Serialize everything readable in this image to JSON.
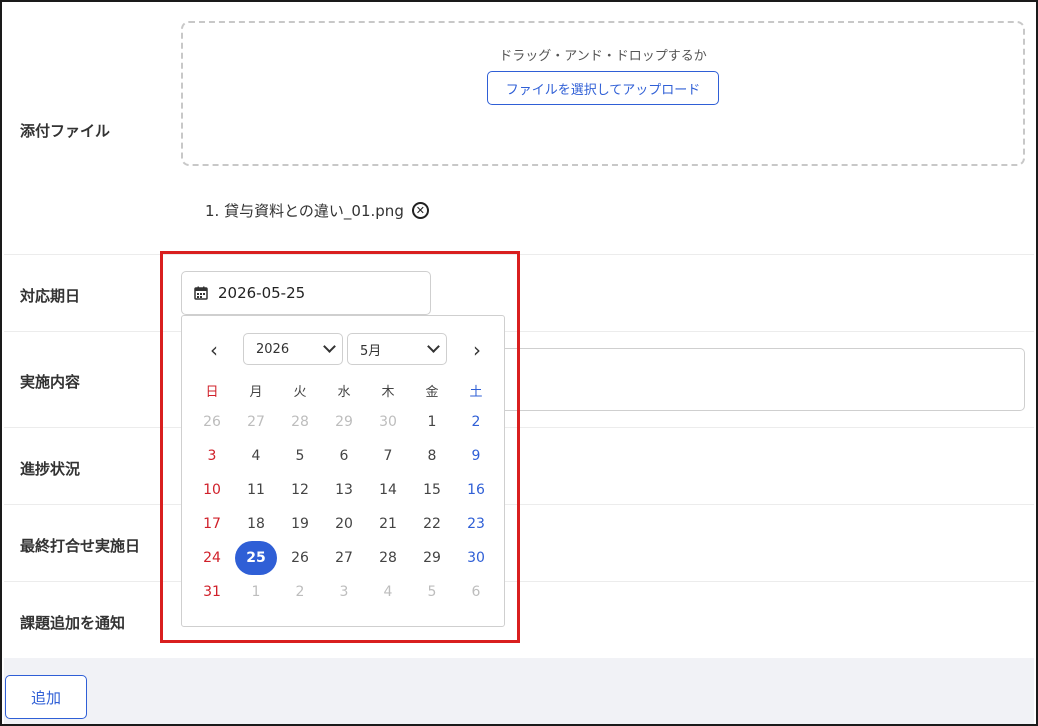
{
  "labels": {
    "attachment": "添付ファイル",
    "due_date": "対応期日",
    "content": "実施内容",
    "progress": "進捗状況",
    "last_meeting": "最終打合せ実施日",
    "notify": "課題追加を通知"
  },
  "dropzone": {
    "hint": "ドラッグ・アンド・ドロップするか",
    "button": "ファイルを選択してアップロード"
  },
  "files": [
    {
      "name": "1. 貸与資料との違い_01.png"
    }
  ],
  "date_input": {
    "value": "2026-05-25"
  },
  "calendar": {
    "year": "2026",
    "month": "5月",
    "weekdays": [
      "日",
      "月",
      "火",
      "水",
      "木",
      "金",
      "土"
    ],
    "weeks": [
      [
        "26",
        "27",
        "28",
        "29",
        "30",
        "1",
        "2"
      ],
      [
        "3",
        "4",
        "5",
        "6",
        "7",
        "8",
        "9"
      ],
      [
        "10",
        "11",
        "12",
        "13",
        "14",
        "15",
        "16"
      ],
      [
        "17",
        "18",
        "19",
        "20",
        "21",
        "22",
        "23"
      ],
      [
        "24",
        "25",
        "26",
        "27",
        "28",
        "29",
        "30"
      ],
      [
        "31",
        "1",
        "2",
        "3",
        "4",
        "5",
        "6"
      ]
    ],
    "selected": "25"
  },
  "footer": {
    "add_button": "追加"
  },
  "colors": {
    "accent": "#2f5fd6",
    "sunday": "#d0202a",
    "highlight": "#d91f1f"
  }
}
